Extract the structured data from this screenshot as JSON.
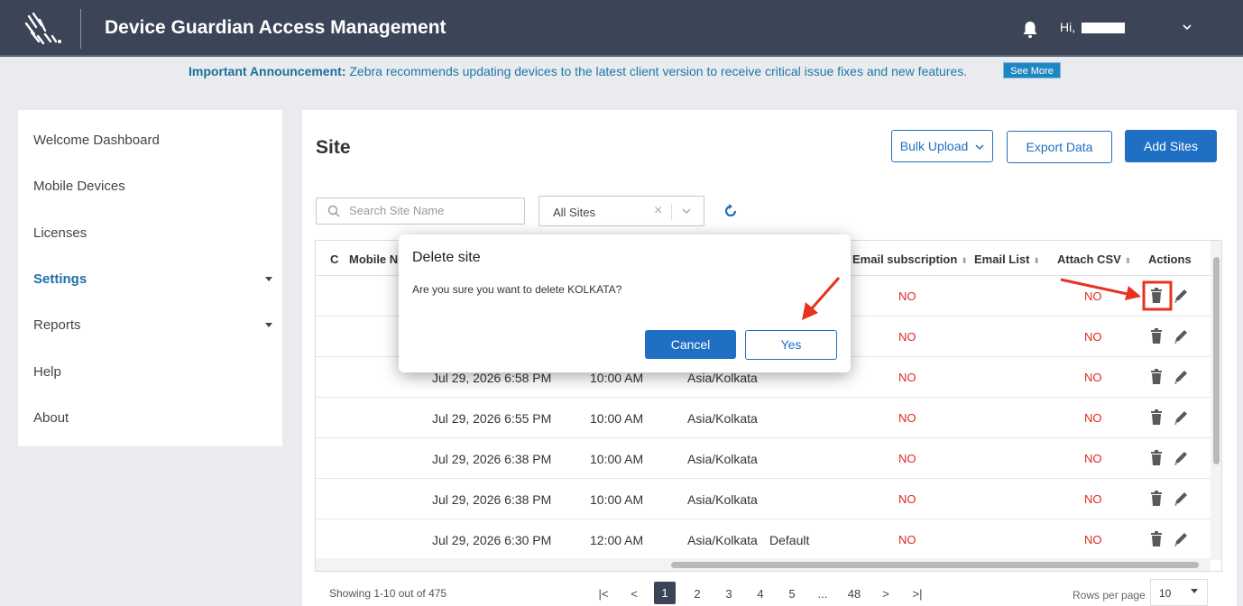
{
  "header": {
    "app_title": "Device Guardian Access Management",
    "greeting": "Hi,"
  },
  "announcement": {
    "label": "Important Announcement:",
    "text": " Zebra recommends updating devices to the latest client version to receive critical issue fixes and new features.",
    "link": "See More"
  },
  "sidebar": {
    "items": [
      {
        "label": "Welcome Dashboard"
      },
      {
        "label": "Mobile Devices"
      },
      {
        "label": "Licenses"
      },
      {
        "label": "Settings"
      },
      {
        "label": "Reports"
      },
      {
        "label": "Help"
      },
      {
        "label": "About"
      }
    ]
  },
  "page": {
    "title": "Site",
    "bulk_upload": "Bulk Upload",
    "export_data": "Export Data",
    "add_sites": "Add Sites",
    "search_placeholder": "Search Site Name",
    "filter_value": "All Sites"
  },
  "table": {
    "headers": [
      "C",
      "Mobile N",
      "Email subscription",
      "Email List",
      "Attach CSV",
      "Actions"
    ],
    "rows": [
      {
        "date": "",
        "time": "",
        "tz": "",
        "default": "",
        "email_sub": "NO",
        "attach_csv": "NO"
      },
      {
        "date": "",
        "time": "",
        "tz": "",
        "default": "",
        "email_sub": "NO",
        "attach_csv": "NO"
      },
      {
        "date": "Jul 29, 2026 6:58 PM",
        "time": "10:00 AM",
        "tz": "Asia/Kolkata",
        "default": "",
        "email_sub": "NO",
        "attach_csv": "NO"
      },
      {
        "date": "Jul 29, 2026 6:55 PM",
        "time": "10:00 AM",
        "tz": "Asia/Kolkata",
        "default": "",
        "email_sub": "NO",
        "attach_csv": "NO"
      },
      {
        "date": "Jul 29, 2026 6:38 PM",
        "time": "10:00 AM",
        "tz": "Asia/Kolkata",
        "default": "",
        "email_sub": "NO",
        "attach_csv": "NO"
      },
      {
        "date": "Jul 29, 2026 6:38 PM",
        "time": "10:00 AM",
        "tz": "Asia/Kolkata",
        "default": "",
        "email_sub": "NO",
        "attach_csv": "NO"
      },
      {
        "date": "Jul 29, 2026 6:30 PM",
        "time": "12:00 AM",
        "tz": "Asia/Kolkata",
        "default": "Default",
        "email_sub": "NO",
        "attach_csv": "NO"
      }
    ]
  },
  "pagination": {
    "info": "Showing 1-10 out of 475",
    "first": "|<",
    "prev": "<",
    "next": ">",
    "last": ">|",
    "pages": [
      "1",
      "2",
      "3",
      "4",
      "5",
      "...",
      "48"
    ],
    "current": "1",
    "rows_label": "Rows per page",
    "rows_value": "10"
  },
  "modal": {
    "title": "Delete site",
    "message": "Are you sure you want to delete KOLKATA?",
    "cancel": "Cancel",
    "yes": "Yes"
  },
  "colors": {
    "header_bg": "#3b4557",
    "primary": "#1f6fc4",
    "no_red": "#e0281e",
    "annotation": "#e8321e"
  }
}
